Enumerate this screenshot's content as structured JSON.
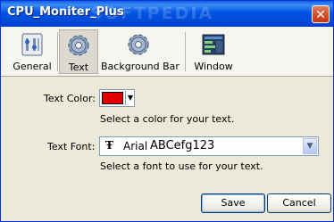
{
  "window": {
    "title": "CPU_Moniter_Plus",
    "watermark": "SOFTPEDIA",
    "close_symbol": "✕"
  },
  "tabs": [
    {
      "label": "General",
      "icon": "settings-panel-icon"
    },
    {
      "label": "Text",
      "icon": "gear-icon",
      "selected": true
    },
    {
      "label": "Background Bar",
      "icon": "gear-icon"
    },
    {
      "label": "Window",
      "icon": "window-icon"
    }
  ],
  "text_color": {
    "label": "Text Color:",
    "value": "#e00000",
    "hint": "Select a color for your text."
  },
  "text_font": {
    "label": "Text Font:",
    "font_icon": "Ŧ",
    "value": "Arial",
    "sample": "ABCefg123",
    "hint": "Select a font to use for your text."
  },
  "buttons": {
    "save": "Save",
    "cancel": "Cancel"
  },
  "colors": {
    "titlebar": "#0054e3",
    "dialog_bg": "#ece9d8",
    "selected_color": "#e00000"
  }
}
